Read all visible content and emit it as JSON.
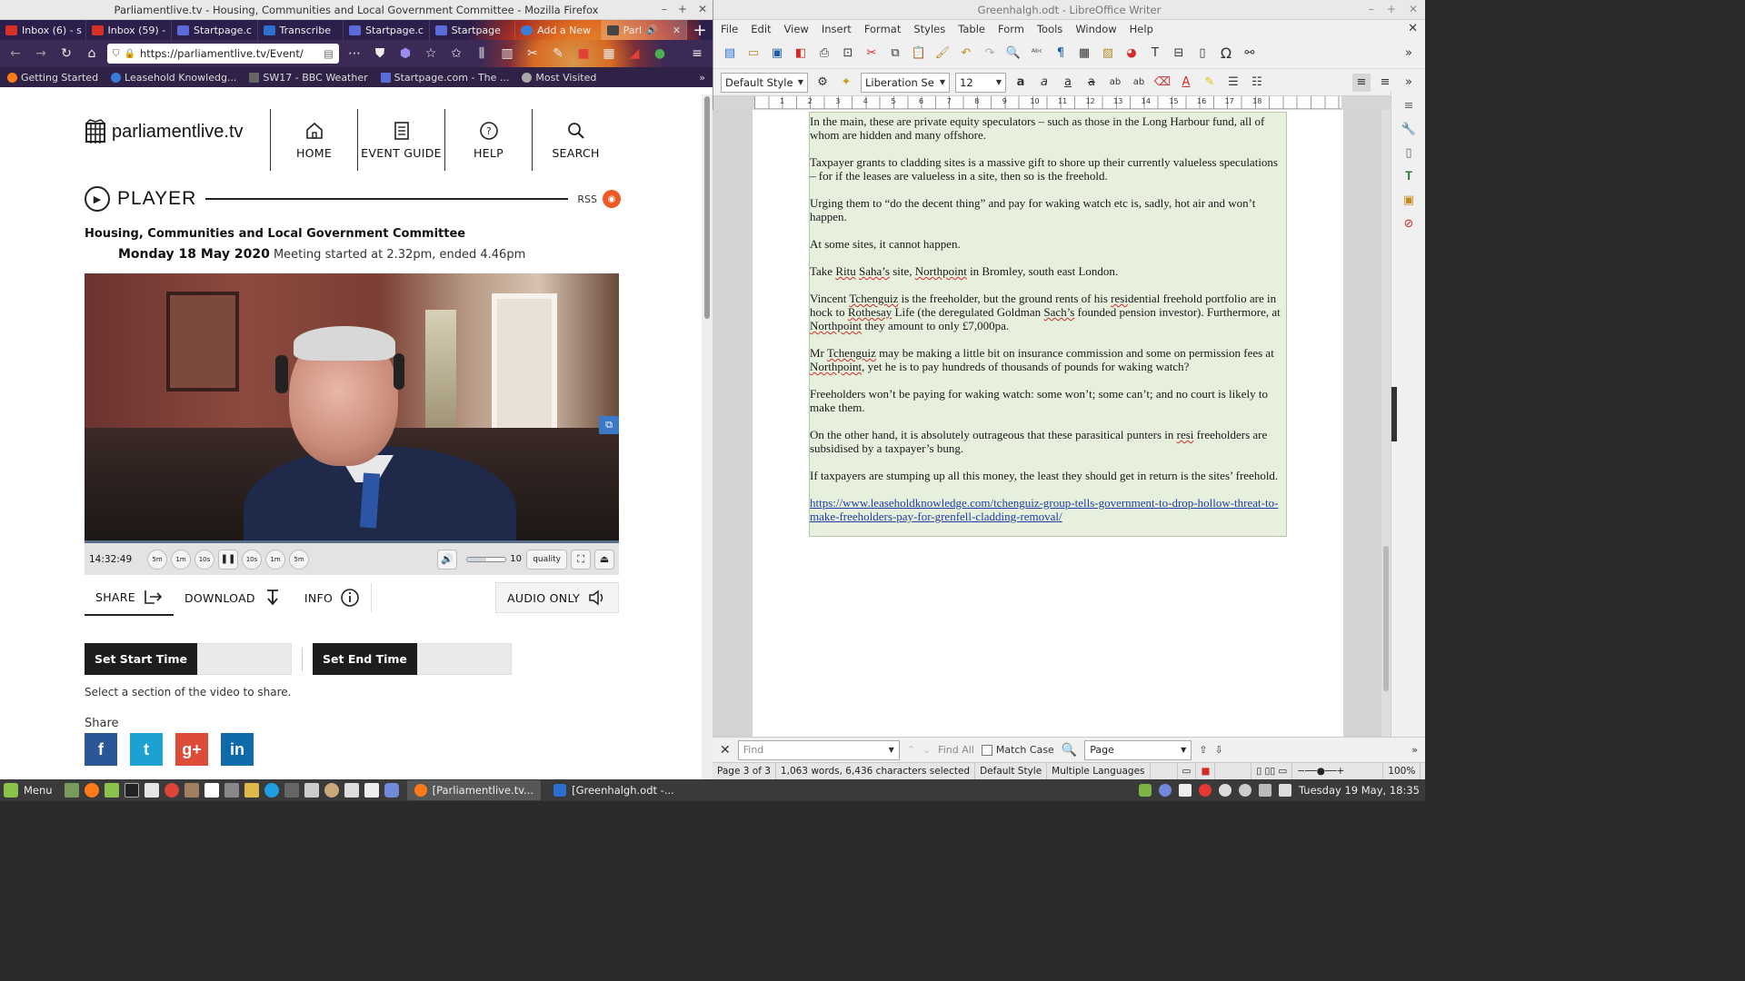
{
  "firefox": {
    "window_title": "Parliamentlive.tv - Housing, Communities and Local Government Committee - Mozilla Firefox",
    "tabs": [
      {
        "label": "Inbox (6) - s",
        "color": "#d93025"
      },
      {
        "label": "Inbox (59) -",
        "color": "#d93025"
      },
      {
        "label": "Startpage.c",
        "color": "#5b6bd8"
      },
      {
        "label": "Transcribe",
        "color": "#2f6fd0"
      },
      {
        "label": "Startpage.c",
        "color": "#5b6bd8"
      },
      {
        "label": "Startpage",
        "color": "#5b6bd8"
      },
      {
        "label": "Add a New",
        "color": "#3b7dd8"
      },
      {
        "label": "Parl",
        "color": "#444"
      }
    ],
    "url": "https://parliamentlive.tv/Event/",
    "bookmarks": [
      {
        "label": "Getting Started",
        "color": "#ff7a18"
      },
      {
        "label": "Leasehold Knowledg...",
        "color": "#3a7bd5"
      },
      {
        "label": "SW17 - BBC Weather",
        "color": "#666"
      },
      {
        "label": "Startpage.com - The ...",
        "color": "#5b6bd8"
      },
      {
        "label": "Most Visited",
        "color": "#aaa"
      }
    ]
  },
  "page": {
    "logo": "parliamentlive.tv",
    "nav": [
      {
        "label": "HOME",
        "icon": "home-icon"
      },
      {
        "label": "EVENT GUIDE",
        "icon": "document-icon"
      },
      {
        "label": "HELP",
        "icon": "question-icon"
      },
      {
        "label": "SEARCH",
        "icon": "search-icon"
      }
    ],
    "player_label": "PLAYER",
    "rss_label": "RSS",
    "committee": "Housing, Communities and Local Government Committee",
    "date": "Monday 18 May 2020",
    "meeting_info": "Meeting started at 2.32pm, ended 4.46pm",
    "video": {
      "current_time": "14:32:49",
      "skip_buttons": [
        "5m",
        "1m",
        "10s",
        "10s",
        "1m",
        "5m"
      ],
      "volume": 10,
      "volume_fraction": 0.5,
      "quality_label": "quality"
    },
    "actions": {
      "share": "SHARE",
      "download": "DOWNLOAD",
      "info": "INFO",
      "audio_only": "AUDIO ONLY"
    },
    "set_start": "Set Start Time",
    "set_end": "Set End Time",
    "set_help": "Select a section of the video to share.",
    "share_heading": "Share",
    "social": [
      {
        "label": "f",
        "name": "facebook",
        "color": "#2b5698"
      },
      {
        "label": "t",
        "name": "twitter",
        "color": "#1da1d2"
      },
      {
        "label": "g+",
        "name": "google-plus",
        "color": "#dd4b39"
      },
      {
        "label": "in",
        "name": "linkedin",
        "color": "#0e6aa8"
      }
    ]
  },
  "writer": {
    "window_title": "Greenhalgh.odt - LibreOffice Writer",
    "menu": [
      "File",
      "Edit",
      "View",
      "Insert",
      "Format",
      "Styles",
      "Table",
      "Form",
      "Tools",
      "Window",
      "Help"
    ],
    "paragraph_style": "Default Style",
    "font_name": "Liberation Se",
    "font_size": "12",
    "ruler_numbers": [
      "1",
      "2",
      "3",
      "4",
      "5",
      "6",
      "7",
      "8",
      "9",
      "10",
      "11",
      "12",
      "13",
      "14",
      "15",
      "16",
      "17",
      "18"
    ],
    "paragraphs": [
      "In the main, these are private equity speculators – such as those in the Long Harbour fund, all of whom are hidden and many offshore.",
      "Taxpayer grants to cladding sites is a massive gift to shore up their currently valueless speculations – for if the leases are valueless in a site, then so is the freehold.",
      "Urging them to “do the decent thing” and pay for waking watch etc is, sadly, hot air and won’t happen.",
      "At some sites, it cannot happen.",
      "Take Ritu Saha’s site, Northpoint in Bromley, south east London.",
      "Vincent Tchenguiz is the freeholder, but the ground rents of his residential freehold portfolio are in hock to Rothesay Life (the deregulated Goldman Sach’s founded pension investor). Furthermore, at Northpoint they amount to only £7,000pa.",
      "Mr Tchenguiz may be making a little bit on insurance commission and some on permission fees at Northpoint, yet he is to pay hundreds of thousands of pounds for waking watch?",
      "Freeholders won’t be paying for waking watch: some won’t; some can’t; and no court is likely to make them.",
      "On the other hand, it is absolutely outrageous that these parasitical punters in resi freeholders are subsidised by a taxpayer’s bung.",
      "If taxpayers are stumping up all this money, the least they should get in return is the sites’ freehold."
    ],
    "link": "https://www.leaseholdknowledge.com/tchenguiz-group-tells-government-to-drop-hollow-threat-to-make-freeholders-pay-for-grenfell-cladding-removal/",
    "find": {
      "placeholder": "Find",
      "find_all": "Find All",
      "match_case": "Match Case",
      "scope": "Page"
    },
    "status": {
      "page": "Page 3 of 3",
      "words": "1,063 words, 6,436 characters selected",
      "style": "Default Style",
      "language": "Multiple Languages",
      "zoom": "100%"
    }
  },
  "taskbar": {
    "menu_label": "Menu",
    "tasks": [
      {
        "label": "[Parliamentlive.tv...",
        "color": "#ff7a18",
        "active": true
      },
      {
        "label": "[Greenhalgh.odt -...",
        "color": "#2a6fd0",
        "active": false
      }
    ],
    "clock": "Tuesday 19 May, 18:35"
  }
}
